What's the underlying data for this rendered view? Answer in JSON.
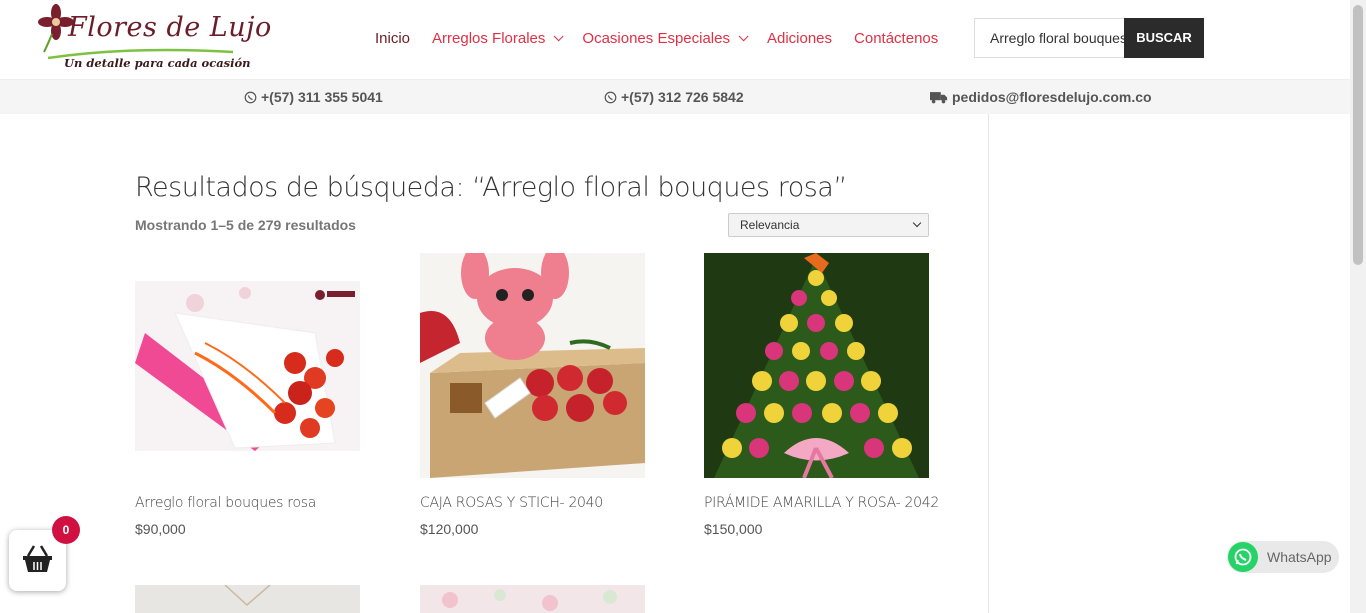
{
  "brand": {
    "name": "Flores de Lujo",
    "tagline": "Un detalle para cada ocasión"
  },
  "nav": {
    "items": [
      {
        "label": "Inicio",
        "has_dropdown": false,
        "active": true
      },
      {
        "label": "Arreglos Florales",
        "has_dropdown": true
      },
      {
        "label": "Ocasiones Especiales",
        "has_dropdown": true
      },
      {
        "label": "Adiciones",
        "has_dropdown": false
      },
      {
        "label": "Contáctenos",
        "has_dropdown": false
      }
    ]
  },
  "search": {
    "value": "Arreglo floral bouques rosa",
    "button_label": "BUSCAR"
  },
  "infobar": {
    "phone1": "+(57) 311 355 5041",
    "phone2": "+(57) 312 726 5842",
    "email": "pedidos@floresdelujo.com.co"
  },
  "results": {
    "title": "Resultados de búsqueda: “Arreglo floral bouques rosa”",
    "count_text": "Mostrando 1–5 de 279 resultados",
    "orderby_selected": "Relevancia"
  },
  "products": [
    {
      "name": "Arreglo floral bouques rosa",
      "price": "$90,000"
    },
    {
      "name": "CAJA ROSAS Y STICH- 2040",
      "price": "$120,000"
    },
    {
      "name": "PIRÁMIDE AMARILLA Y ROSA- 2042",
      "price": "$150,000"
    }
  ],
  "cart": {
    "count": "0"
  },
  "whatsapp": {
    "label": "WhatsApp"
  },
  "colors": {
    "nav_red": "#e03045",
    "brand_burgundy": "#6b1d2a",
    "button_dark": "#2b2b2b",
    "badge_red": "#d01040",
    "whatsapp_green": "#25d366"
  }
}
